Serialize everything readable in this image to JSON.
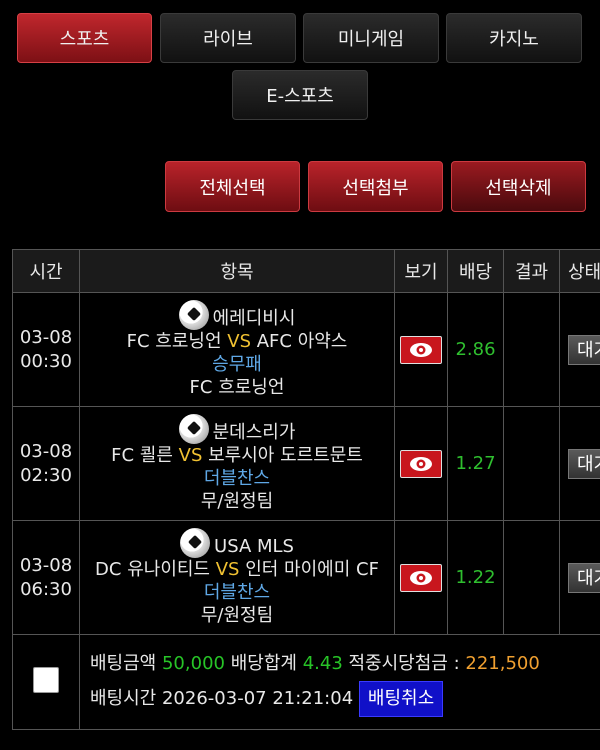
{
  "tabs": [
    {
      "label": "스포츠",
      "active": true
    },
    {
      "label": "라이브",
      "active": false
    },
    {
      "label": "미니게임",
      "active": false
    },
    {
      "label": "카지노",
      "active": false
    },
    {
      "label": "E-스포츠",
      "active": false
    }
  ],
  "actions": {
    "select_all": "전체선택",
    "attach_selected": "선택첨부",
    "delete_selected": "선택삭제"
  },
  "table": {
    "headers": [
      "시간",
      "항목",
      "보기",
      "배당",
      "결과",
      "상태"
    ],
    "rows": [
      {
        "date": "03-08",
        "time": "00:30",
        "league": "에레디비시",
        "home": "FC 흐로닝언",
        "vs": "VS",
        "away": "AFC 아약스",
        "bet_type": "승무패",
        "pick": "FC 흐로닝언",
        "odds": "2.86",
        "status": "대기"
      },
      {
        "date": "03-08",
        "time": "02:30",
        "league": "분데스리가",
        "home": "FC 쾰른",
        "vs": "VS",
        "away": "보루시아 도르트문트",
        "bet_type": "더블찬스",
        "pick": "무/원정팀",
        "odds": "1.27",
        "status": "대기"
      },
      {
        "date": "03-08",
        "time": "06:30",
        "league": "USA MLS",
        "home": "DC 유나이티드",
        "vs": "VS",
        "away": "인터 마이에미 CF",
        "bet_type": "더블찬스",
        "pick": "무/원정팀",
        "odds": "1.22",
        "status": "대기"
      }
    ]
  },
  "summary": {
    "bet_amount_label": "배팅금액",
    "bet_amount": "50,000",
    "odds_total_label": "배당합계",
    "odds_total": "4.43",
    "payout_label": "적중시당첨금 :",
    "payout": "221,500",
    "bet_time_label": "배팅시간",
    "bet_time": "2026-03-07 21:21:04",
    "cancel_label": "배팅취소"
  },
  "colors": {
    "accent_red": "#c0272d",
    "odds_green": "#2fbf2f",
    "vs_yellow": "#f1c232",
    "bet_type_blue": "#5fa8e6",
    "cancel_blue": "#1010c8",
    "payout_orange": "#f0a030"
  }
}
